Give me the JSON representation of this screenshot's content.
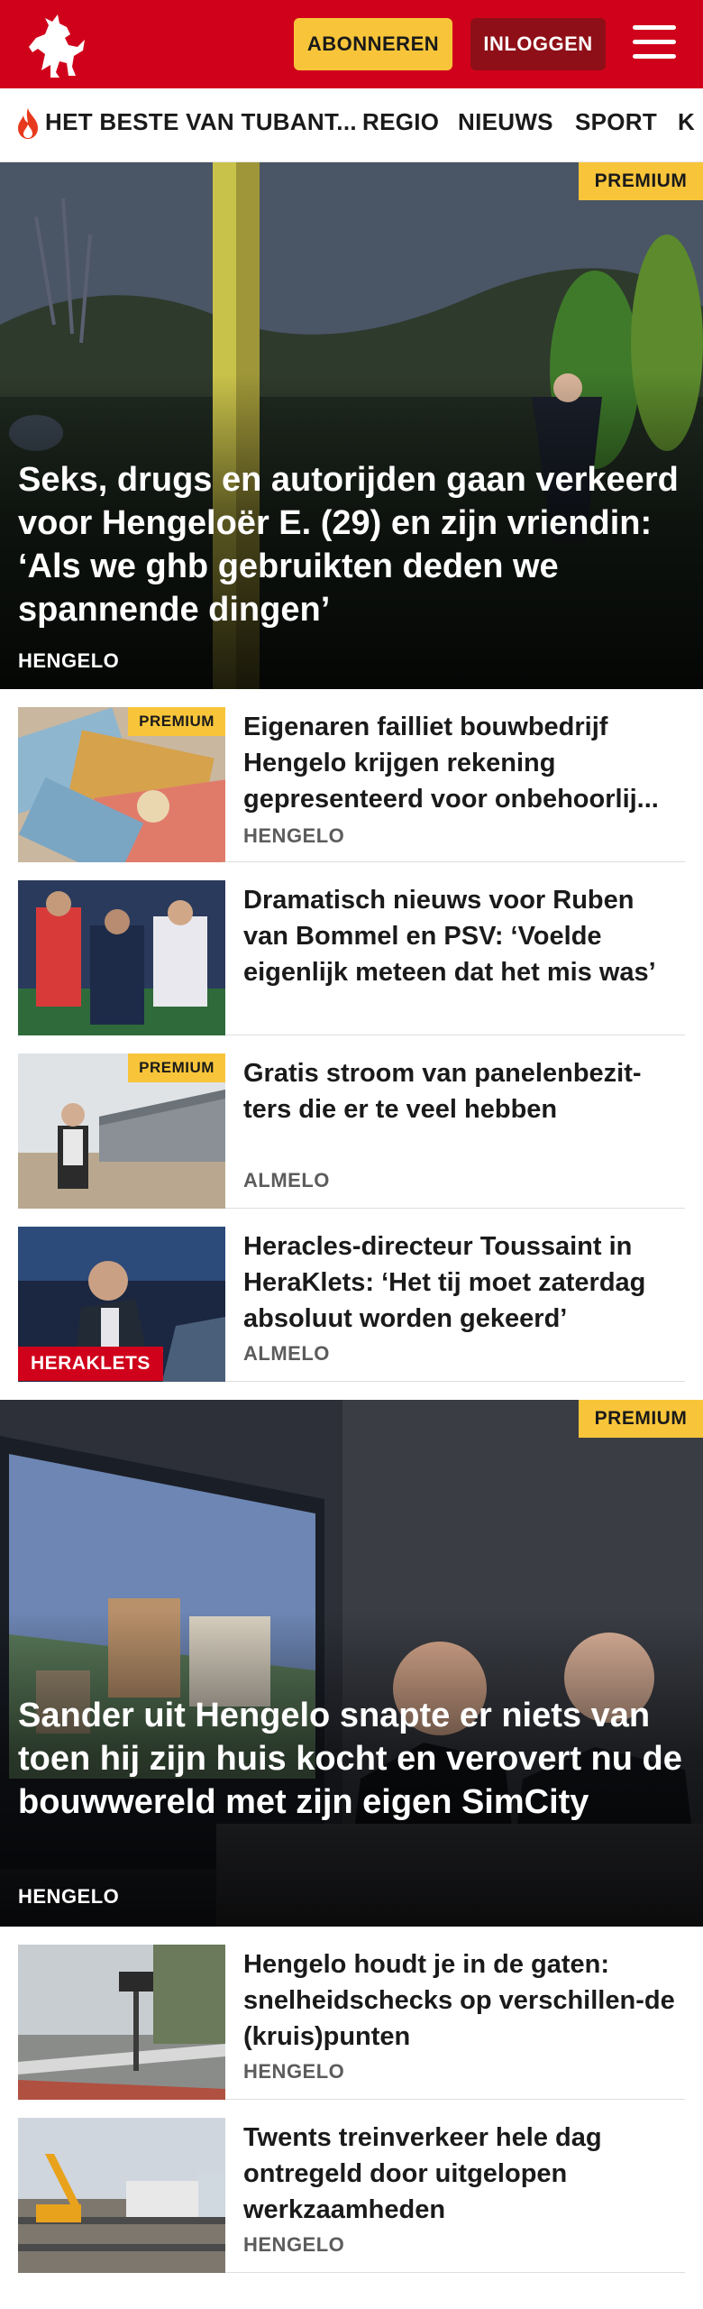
{
  "header": {
    "subscribe_label": "ABONNEREN",
    "login_label": "INLOGGEN"
  },
  "nav": {
    "items": [
      "HET BESTE VAN TUBANT...",
      "REGIO",
      "NIEUWS",
      "SPORT",
      "K"
    ]
  },
  "hero1": {
    "badge": "PREMIUM",
    "title": "Seks, drugs en autorijden gaan verkeerd voor Hengeloër E. (29) en zijn vriendin: ‘Als we ghb gebruikten deden we spannende dingen’",
    "category": "HENGELO"
  },
  "list1": [
    {
      "badge": "PREMIUM",
      "title": "Eigenaren failliet bouwbedrijf Hengelo krijgen rekening gepresenteerd voor onbehoorlij...",
      "category": "HENGELO"
    },
    {
      "title": "Dramatisch nieuws voor Ruben van Bommel en PSV: ‘Voelde eigenlijk meteen dat het mis was’"
    },
    {
      "badge": "PREMIUM",
      "title": "Gratis stroom van panelenbezit-ters die er te veel hebben",
      "category": "ALMELO"
    },
    {
      "tag": "HERAKLETS",
      "title": "Heracles-directeur Toussaint in HeraKlets: ‘Het tij moet zaterdag absoluut worden gekeerd’",
      "category": "ALMELO"
    }
  ],
  "hero2": {
    "badge": "PREMIUM",
    "title": "Sander uit Hengelo snapte er niets van toen hij zijn huis kocht en verovert nu de bouwwereld met zijn eigen SimCity",
    "category": "HENGELO"
  },
  "list2": [
    {
      "title": "Hengelo houdt je in de gaten: snelheidschecks op verschillen-de (kruis)punten",
      "category": "HENGELO"
    },
    {
      "title": "Twents treinverkeer hele dag ontregeld door uitgelopen werkzaamheden",
      "category": "HENGELO"
    }
  ],
  "colors": {
    "brand_red": "#d0021b",
    "premium_yellow": "#f8c53a",
    "login_dark_red": "#8e0f17"
  }
}
